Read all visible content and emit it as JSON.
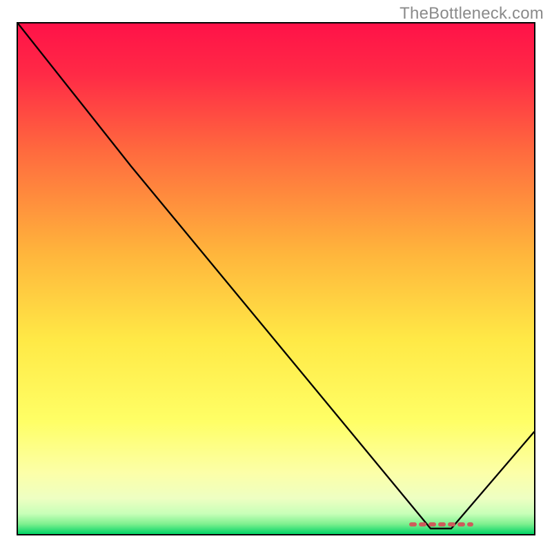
{
  "attribution": "TheBottleneck.com",
  "colors": {
    "frame": "#000000",
    "line": "#000000",
    "marker": "#cd5c5c",
    "gradient_top": "#ff1850",
    "gradient_mid_upper": "#ff8a3a",
    "gradient_mid": "#ffd640",
    "gradient_mid_lower": "#ffff60",
    "gradient_lower": "#f8ffb0",
    "gradient_bottom": "#00d868"
  },
  "chart_data": {
    "type": "line",
    "title": "",
    "xlabel": "",
    "ylabel": "",
    "xlim": [
      0,
      100
    ],
    "ylim": [
      0,
      100
    ],
    "x": [
      0,
      22,
      80,
      84,
      100
    ],
    "values": [
      100,
      72,
      1,
      1,
      20
    ],
    "annotations": [
      {
        "name": "marker-band",
        "x_start": 76,
        "x_end": 88,
        "y": 1.2
      }
    ],
    "background": "vertical-gradient"
  }
}
